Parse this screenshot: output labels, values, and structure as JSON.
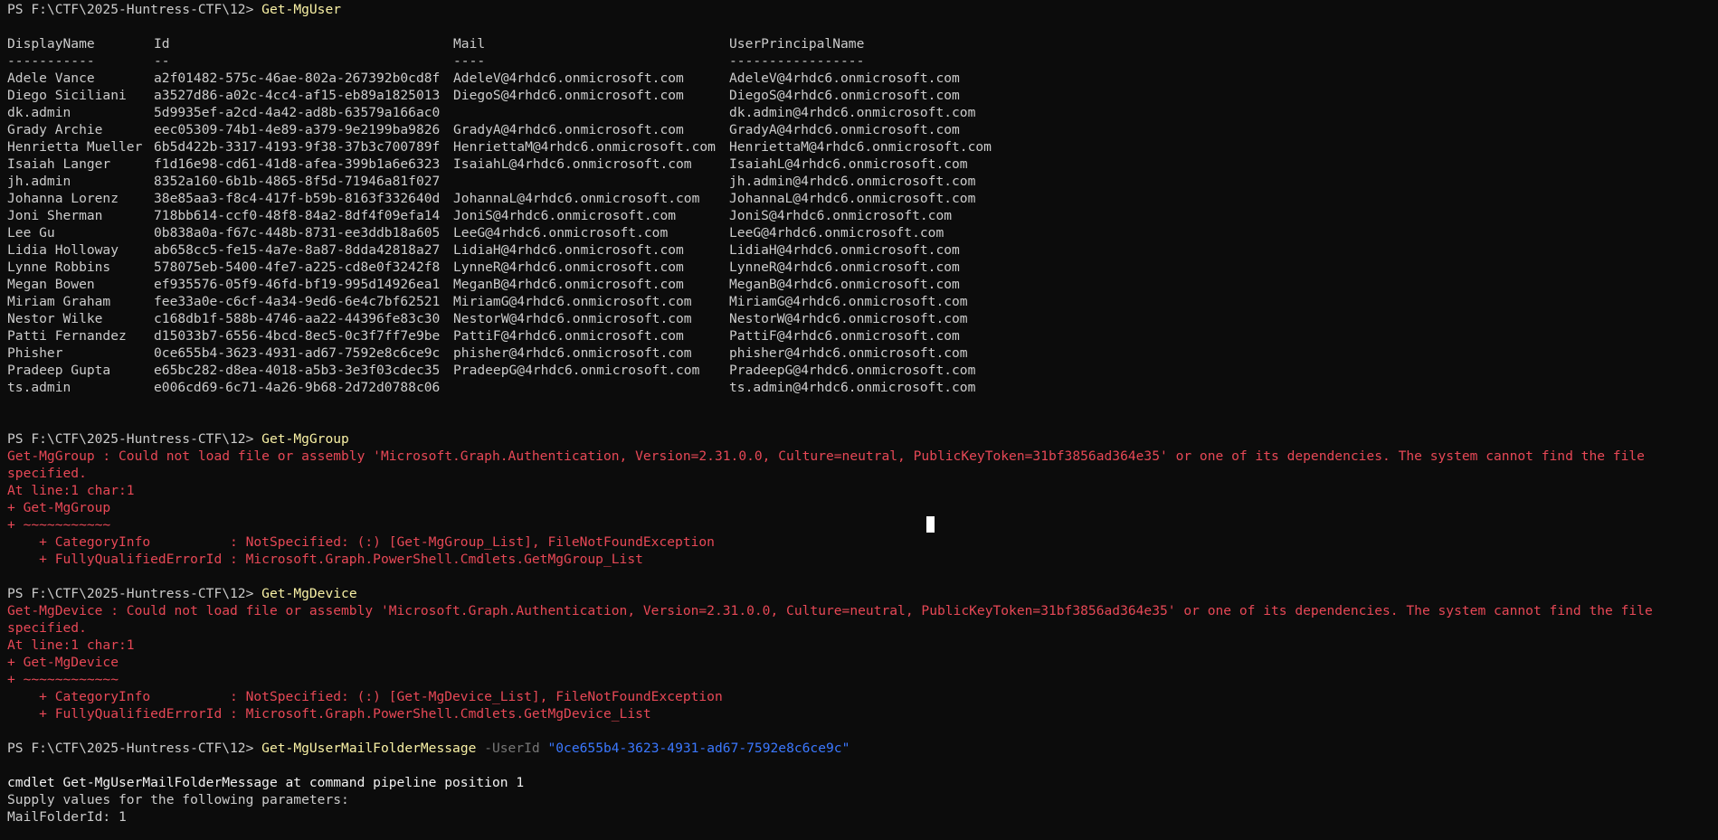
{
  "prompt": "PS F:\\CTF\\2025-Huntress-CTF\\12> ",
  "session1": {
    "command": "Get-MgUser",
    "headers": [
      "DisplayName",
      "Id",
      "Mail",
      "UserPrincipalName"
    ],
    "underlines": [
      "-----------",
      "--",
      "----",
      "-----------------"
    ],
    "rows": [
      [
        "Adele Vance",
        "a2f01482-575c-46ae-802a-267392b0cd8f",
        "AdeleV@4rhdc6.onmicrosoft.com",
        "AdeleV@4rhdc6.onmicrosoft.com"
      ],
      [
        "Diego Siciliani",
        "a3527d86-a02c-4cc4-af15-eb89a1825013",
        "DiegoS@4rhdc6.onmicrosoft.com",
        "DiegoS@4rhdc6.onmicrosoft.com"
      ],
      [
        "dk.admin",
        "5d9935ef-a2cd-4a42-ad8b-63579a166ac0",
        "",
        "dk.admin@4rhdc6.onmicrosoft.com"
      ],
      [
        "Grady Archie",
        "eec05309-74b1-4e89-a379-9e2199ba9826",
        "GradyA@4rhdc6.onmicrosoft.com",
        "GradyA@4rhdc6.onmicrosoft.com"
      ],
      [
        "Henrietta Mueller",
        "6b5d422b-3317-4193-9f38-37b3c700789f",
        "HenriettaM@4rhdc6.onmicrosoft.com",
        "HenriettaM@4rhdc6.onmicrosoft.com"
      ],
      [
        "Isaiah Langer",
        "f1d16e98-cd61-41d8-afea-399b1a6e6323",
        "IsaiahL@4rhdc6.onmicrosoft.com",
        "IsaiahL@4rhdc6.onmicrosoft.com"
      ],
      [
        "jh.admin",
        "8352a160-6b1b-4865-8f5d-71946a81f027",
        "",
        "jh.admin@4rhdc6.onmicrosoft.com"
      ],
      [
        "Johanna Lorenz",
        "38e85aa3-f8c4-417f-b59b-8163f332640d",
        "JohannaL@4rhdc6.onmicrosoft.com",
        "JohannaL@4rhdc6.onmicrosoft.com"
      ],
      [
        "Joni Sherman",
        "718bb614-ccf0-48f8-84a2-8df4f09efa14",
        "JoniS@4rhdc6.onmicrosoft.com",
        "JoniS@4rhdc6.onmicrosoft.com"
      ],
      [
        "Lee Gu",
        "0b838a0a-f67c-448b-8731-ee3ddb18a605",
        "LeeG@4rhdc6.onmicrosoft.com",
        "LeeG@4rhdc6.onmicrosoft.com"
      ],
      [
        "Lidia Holloway",
        "ab658cc5-fe15-4a7e-8a87-8dda42818a27",
        "LidiaH@4rhdc6.onmicrosoft.com",
        "LidiaH@4rhdc6.onmicrosoft.com"
      ],
      [
        "Lynne Robbins",
        "578075eb-5400-4fe7-a225-cd8e0f3242f8",
        "LynneR@4rhdc6.onmicrosoft.com",
        "LynneR@4rhdc6.onmicrosoft.com"
      ],
      [
        "Megan Bowen",
        "ef935576-05f9-46fd-bf19-995d14926ea1",
        "MeganB@4rhdc6.onmicrosoft.com",
        "MeganB@4rhdc6.onmicrosoft.com"
      ],
      [
        "Miriam Graham",
        "fee33a0e-c6cf-4a34-9ed6-6e4c7bf62521",
        "MiriamG@4rhdc6.onmicrosoft.com",
        "MiriamG@4rhdc6.onmicrosoft.com"
      ],
      [
        "Nestor Wilke",
        "c168db1f-588b-4746-aa22-44396fe83c30",
        "NestorW@4rhdc6.onmicrosoft.com",
        "NestorW@4rhdc6.onmicrosoft.com"
      ],
      [
        "Patti Fernandez",
        "d15033b7-6556-4bcd-8ec5-0c3f7ff7e9be",
        "PattiF@4rhdc6.onmicrosoft.com",
        "PattiF@4rhdc6.onmicrosoft.com"
      ],
      [
        "Phisher",
        "0ce655b4-3623-4931-ad67-7592e8c6ce9c",
        "phisher@4rhdc6.onmicrosoft.com",
        "phisher@4rhdc6.onmicrosoft.com"
      ],
      [
        "Pradeep Gupta",
        "e65bc282-d8ea-4018-a5b3-3e3f03cdec35",
        "PradeepG@4rhdc6.onmicrosoft.com",
        "PradeepG@4rhdc6.onmicrosoft.com"
      ],
      [
        "ts.admin",
        "e006cd69-6c71-4a26-9b68-2d72d0788c06",
        "",
        "ts.admin@4rhdc6.onmicrosoft.com"
      ]
    ]
  },
  "session2": {
    "command": "Get-MgGroup",
    "error_line1": "Get-MgGroup : Could not load file or assembly 'Microsoft.Graph.Authentication, Version=2.31.0.0, Culture=neutral, PublicKeyToken=31bf3856ad364e35' or one of its dependencies. The system cannot find the file specified.",
    "error_location": "At line:1 char:1",
    "error_echo": "+ Get-MgGroup",
    "error_tilde": "+ ~~~~~~~~~~~",
    "category_info": "    + CategoryInfo          : NotSpecified: (:) [Get-MgGroup_List], FileNotFoundException",
    "fq_error_id": "    + FullyQualifiedErrorId : Microsoft.Graph.PowerShell.Cmdlets.GetMgGroup_List"
  },
  "session3": {
    "command": "Get-MgDevice",
    "error_line1": "Get-MgDevice : Could not load file or assembly 'Microsoft.Graph.Authentication, Version=2.31.0.0, Culture=neutral, PublicKeyToken=31bf3856ad364e35' or one of its dependencies. The system cannot find the file specified.",
    "error_location": "At line:1 char:1",
    "error_echo": "+ Get-MgDevice",
    "error_tilde": "+ ~~~~~~~~~~~~",
    "category_info": "    + CategoryInfo          : NotSpecified: (:) [Get-MgDevice_List], FileNotFoundException",
    "fq_error_id": "    + FullyQualifiedErrorId : Microsoft.Graph.PowerShell.Cmdlets.GetMgDevice_List"
  },
  "session4": {
    "command": "Get-MgUserMailFolderMessage",
    "param_name": " -UserId ",
    "param_value": "\"0ce655b4-3623-4931-ad67-7592e8c6ce9c\"",
    "output_line1": "cmdlet Get-MgUserMailFolderMessage at command pipeline position 1",
    "output_line2": "Supply values for the following parameters:",
    "output_line3": "MailFolderId: 1"
  },
  "colors": {
    "background": "#0c0c0c",
    "foreground": "#cccccc",
    "command": "#f9f1a5",
    "parameter": "#767676",
    "string": "#3b78ff",
    "error": "#e74856"
  }
}
